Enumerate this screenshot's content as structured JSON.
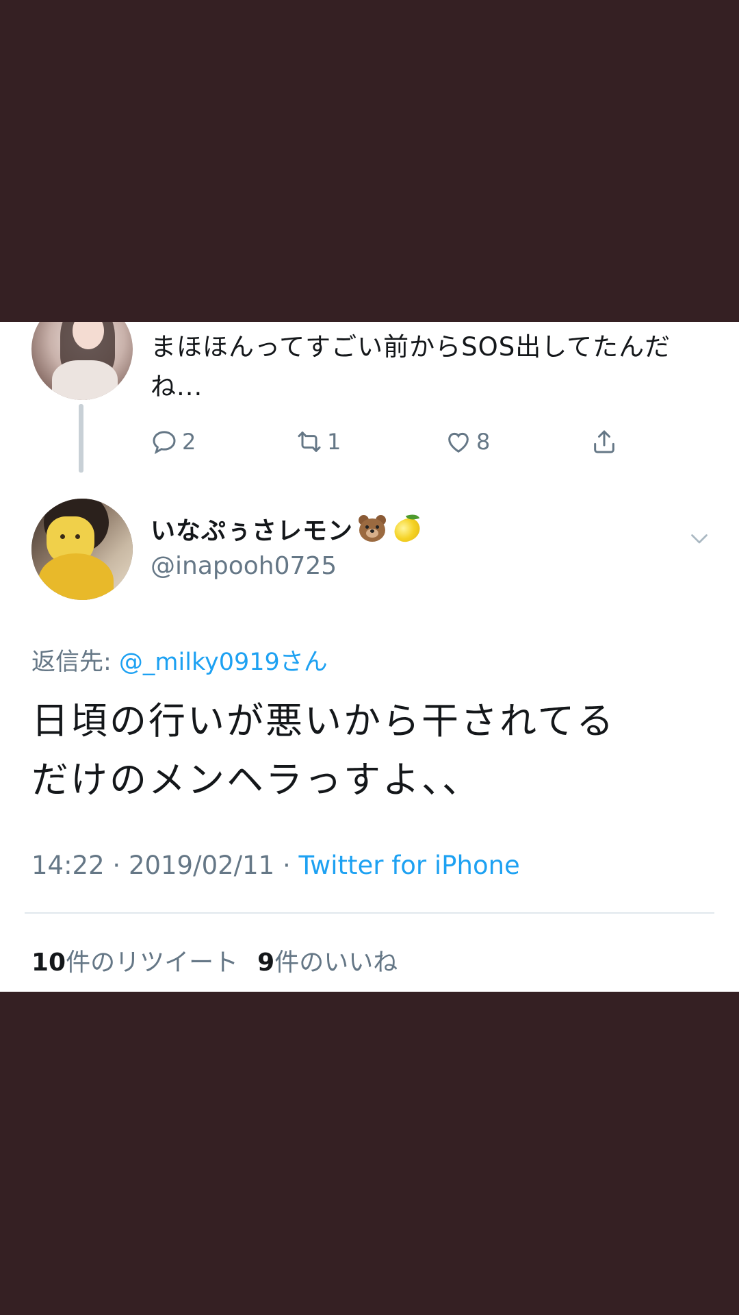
{
  "previous_tweet": {
    "text": "まほほんってすごい前からSOS出してたんだね...",
    "reply_count": "2",
    "retweet_count": "1",
    "like_count": "8"
  },
  "tweet": {
    "display_name": "いなぷぅさレモン",
    "name_emojis": [
      "bear-face",
      "lemon"
    ],
    "screen_name": "@inapooh0725",
    "reply_to_label": "返信先: ",
    "reply_to_mention": "@_milky0919さん",
    "text_line1": "日頃の行いが悪いから干されてる",
    "text_line2": "だけのメンヘラっすよ、、",
    "time": "14:22",
    "date": "2019/02/11",
    "source": "Twitter for iPhone",
    "separator": " · "
  },
  "stats": {
    "retweets_count": "10",
    "retweets_label": "件のリツイート",
    "likes_count": "9",
    "likes_label": "件のいいね"
  },
  "colors": {
    "background_frame": "#352023",
    "card": "#ffffff",
    "text_primary": "#14171a",
    "text_secondary": "#657786",
    "link": "#1da1f2"
  }
}
